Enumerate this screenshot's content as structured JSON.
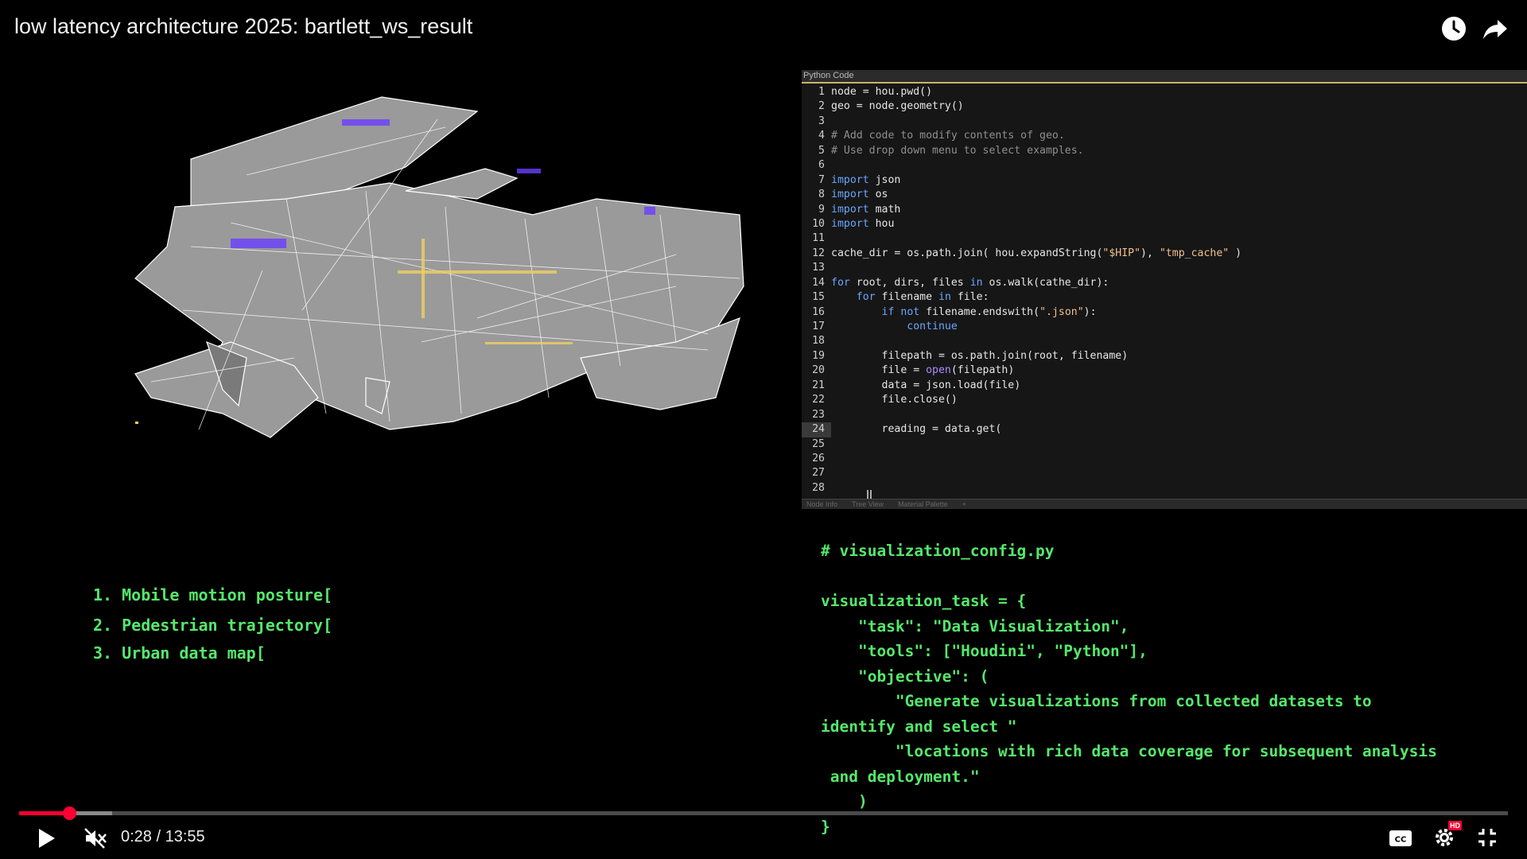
{
  "video": {
    "title": "low latency architecture 2025: bartlett_ws_result",
    "current_time": "0:28",
    "separator": "/",
    "duration": "13:55",
    "progress_fraction": 0.0337,
    "buffered_fraction": 0.0625
  },
  "editor": {
    "panel_title": "Python Code",
    "active_line": 24,
    "lines": [
      "node = hou.pwd()",
      "geo = node.geometry()",
      "",
      "# Add code to modify contents of geo.",
      "# Use drop down menu to select examples.",
      "",
      "import json",
      "import os",
      "import math",
      "import hou",
      "",
      "cache_dir = os.path.join( hou.expandString(\"$HIP\"), \"tmp_cache\" )",
      "",
      "for root, dirs, files in os.walk(cathe_dir):",
      "    for filename in file:",
      "        if not filename.endswith(\".json\"):",
      "            continue",
      "",
      "        filepath = os.path.join(root, filename)",
      "        file = open(filepath)",
      "        data = json.load(file)",
      "        file.close()",
      "",
      "        reading = data.get(",
      "",
      "",
      "",
      ""
    ],
    "bottom_tabs": [
      "Node Info",
      "Tree View",
      "Material Palette",
      "+"
    ]
  },
  "overlay_list": [
    "1. Mobile motion posture[",
    "2. Pedestrian trajectory[",
    "3. Urban data map["
  ],
  "config_code": [
    "# visualization_config.py",
    "",
    "visualization_task = {",
    "    \"task\": \"Data Visualization\",",
    "    \"tools\": [\"Houdini\", \"Python\"],",
    "    \"objective\": (",
    "        \"Generate visualizations from collected datasets to",
    "identify and select \"",
    "        \"locations with rich data coverage for subsequent analysis",
    " and deployment.\"",
    "    )",
    "}"
  ],
  "icons": {
    "watch_later": "clock-icon",
    "share": "share-arrow-icon",
    "play": "play-icon",
    "mute": "muted-speaker-icon",
    "captions": "cc-icon",
    "settings": "gear-icon",
    "hd_badge": "HD",
    "exit_fullscreen": "exit-fullscreen-icon"
  },
  "colors": {
    "progress_played": "#ff0033",
    "terminal_green": "#55e86b",
    "editor_bg": "#161616"
  }
}
